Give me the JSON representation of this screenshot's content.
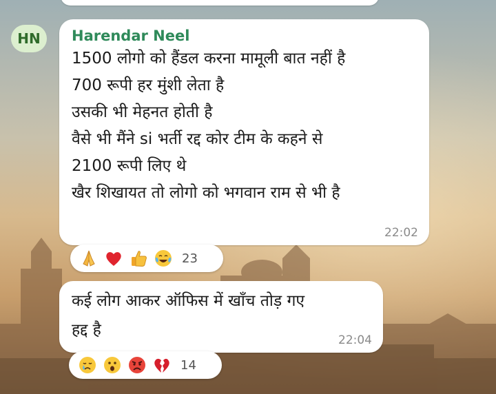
{
  "message1": {
    "avatar_initials": "HN",
    "sender": "Harendar Neel",
    "lines": [
      "1500 लोगो को हैंडल करना मामूली बात नहीं है",
      "700 रूपी हर मुंशी लेता है",
      "उसकी भी मेहनत होती है",
      "वैसे भी मैंने si भर्ती रद्द कोर टीम के कहने से",
      "2100 रूपी लिए थे",
      "खैर शिखायत तो लोगो को भगवान राम से भी है"
    ],
    "time": "22:02",
    "reactions": [
      "folded-hands",
      "red-heart",
      "thumbs-up",
      "tears-of-joy"
    ],
    "reaction_count": "23"
  },
  "message2": {
    "lines": [
      "कई लोग आकर ऑफिस में खाँच तोड़ गए",
      "हद्द है"
    ],
    "time": "22:04",
    "reactions": [
      "crying-face",
      "astonished-face",
      "angry-face",
      "broken-heart"
    ],
    "reaction_count": "14"
  },
  "colors": {
    "sender_name": "#2f8a5a",
    "avatar_bg": "#dcefcf",
    "bubble_bg": "#ffffff",
    "timestamp": "#8a8a8a"
  }
}
